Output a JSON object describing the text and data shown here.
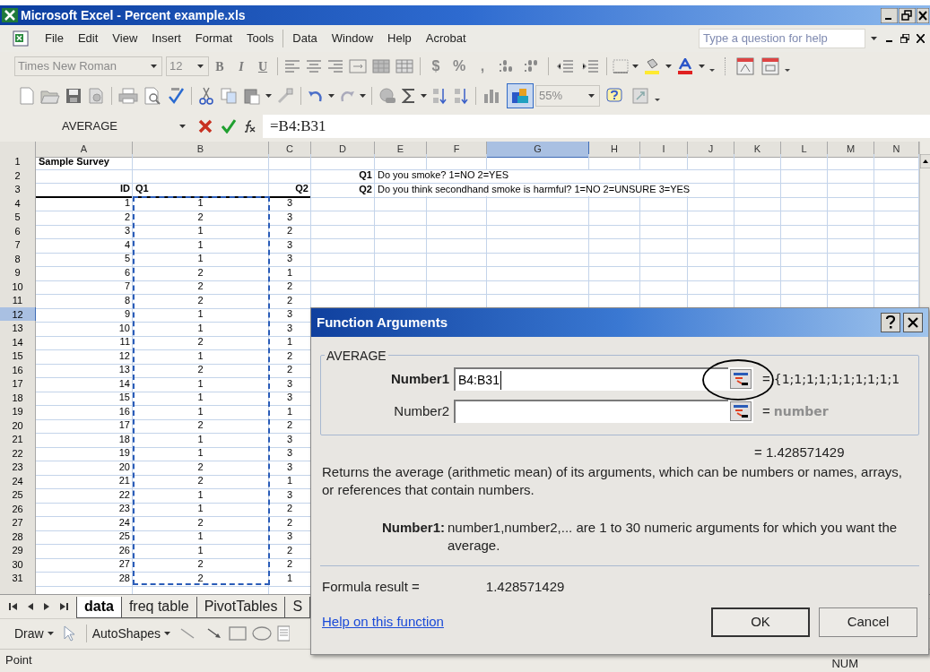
{
  "window": {
    "title": "Microsoft Excel - Percent example.xls"
  },
  "menu": [
    "File",
    "Edit",
    "View",
    "Insert",
    "Format",
    "Tools",
    "Data",
    "Window",
    "Help",
    "Acrobat"
  ],
  "help_box": {
    "placeholder": "Type a question for help"
  },
  "formatting_toolbar": {
    "font": "Times New Roman",
    "size": "12",
    "style_buttons": [
      "B",
      "I",
      "U"
    ],
    "number_buttons": [
      "$",
      "%",
      ","
    ]
  },
  "standard_toolbar": {
    "zoom": "55%"
  },
  "formula_bar": {
    "name_box": "AVERAGE",
    "formula": "=B4:B31"
  },
  "sheet": {
    "columns": [
      {
        "label": "A",
        "selected": false
      },
      {
        "label": "B",
        "selected": false
      },
      {
        "label": "C",
        "selected": false
      },
      {
        "label": "D",
        "selected": false
      },
      {
        "label": "E",
        "selected": false
      },
      {
        "label": "F",
        "selected": false
      },
      {
        "label": "G",
        "selected": true
      },
      {
        "label": "H",
        "selected": false
      },
      {
        "label": "I",
        "selected": false
      },
      {
        "label": "J",
        "selected": false
      },
      {
        "label": "K",
        "selected": false
      },
      {
        "label": "L",
        "selected": false
      },
      {
        "label": "M",
        "selected": false
      },
      {
        "label": "N",
        "selected": false
      }
    ],
    "rows": [
      {
        "number": "1",
        "selected": false,
        "kind": "title",
        "col_a": "Sample Survey"
      },
      {
        "number": "2",
        "selected": false,
        "kind": "note",
        "col_d": "Q1",
        "col_e": "Do you smoke? 1=NO  2=YES"
      },
      {
        "number": "3",
        "selected": false,
        "kind": "header",
        "col_a": "ID",
        "col_b": "Q1",
        "col_c": "Q2",
        "col_d": "Q2",
        "col_e": "Do you think secondhand smoke is harmful?  1=NO  2=UNSURE  3=YES"
      },
      {
        "number": "4",
        "selected": false,
        "kind": "data",
        "col_a": "1",
        "col_b": "1",
        "col_c": "3"
      },
      {
        "number": "5",
        "selected": false,
        "kind": "data",
        "col_a": "2",
        "col_b": "2",
        "col_c": "3"
      },
      {
        "number": "6",
        "selected": false,
        "kind": "data",
        "col_a": "3",
        "col_b": "1",
        "col_c": "2"
      },
      {
        "number": "7",
        "selected": false,
        "kind": "data",
        "col_a": "4",
        "col_b": "1",
        "col_c": "3"
      },
      {
        "number": "8",
        "selected": false,
        "kind": "data",
        "col_a": "5",
        "col_b": "1",
        "col_c": "3"
      },
      {
        "number": "9",
        "selected": false,
        "kind": "data",
        "col_a": "6",
        "col_b": "2",
        "col_c": "1"
      },
      {
        "number": "10",
        "selected": false,
        "kind": "data",
        "col_a": "7",
        "col_b": "2",
        "col_c": "2"
      },
      {
        "number": "11",
        "selected": false,
        "kind": "data",
        "col_a": "8",
        "col_b": "2",
        "col_c": "2"
      },
      {
        "number": "12",
        "selected": true,
        "kind": "data",
        "col_a": "9",
        "col_b": "1",
        "col_c": "3"
      },
      {
        "number": "13",
        "selected": false,
        "kind": "data",
        "col_a": "10",
        "col_b": "1",
        "col_c": "3"
      },
      {
        "number": "14",
        "selected": false,
        "kind": "data",
        "col_a": "11",
        "col_b": "2",
        "col_c": "1"
      },
      {
        "number": "15",
        "selected": false,
        "kind": "data",
        "col_a": "12",
        "col_b": "1",
        "col_c": "2"
      },
      {
        "number": "16",
        "selected": false,
        "kind": "data",
        "col_a": "13",
        "col_b": "2",
        "col_c": "2"
      },
      {
        "number": "17",
        "selected": false,
        "kind": "data",
        "col_a": "14",
        "col_b": "1",
        "col_c": "3"
      },
      {
        "number": "18",
        "selected": false,
        "kind": "data",
        "col_a": "15",
        "col_b": "1",
        "col_c": "3"
      },
      {
        "number": "19",
        "selected": false,
        "kind": "data",
        "col_a": "16",
        "col_b": "1",
        "col_c": "1"
      },
      {
        "number": "20",
        "selected": false,
        "kind": "data",
        "col_a": "17",
        "col_b": "2",
        "col_c": "2"
      },
      {
        "number": "21",
        "selected": false,
        "kind": "data",
        "col_a": "18",
        "col_b": "1",
        "col_c": "3"
      },
      {
        "number": "22",
        "selected": false,
        "kind": "data",
        "col_a": "19",
        "col_b": "1",
        "col_c": "3"
      },
      {
        "number": "23",
        "selected": false,
        "kind": "data",
        "col_a": "20",
        "col_b": "2",
        "col_c": "3"
      },
      {
        "number": "24",
        "selected": false,
        "kind": "data",
        "col_a": "21",
        "col_b": "2",
        "col_c": "1"
      },
      {
        "number": "25",
        "selected": false,
        "kind": "data",
        "col_a": "22",
        "col_b": "1",
        "col_c": "3"
      },
      {
        "number": "26",
        "selected": false,
        "kind": "data",
        "col_a": "23",
        "col_b": "1",
        "col_c": "2"
      },
      {
        "number": "27",
        "selected": false,
        "kind": "data",
        "col_a": "24",
        "col_b": "2",
        "col_c": "2"
      },
      {
        "number": "28",
        "selected": false,
        "kind": "data",
        "col_a": "25",
        "col_b": "1",
        "col_c": "3"
      },
      {
        "number": "29",
        "selected": false,
        "kind": "data",
        "col_a": "26",
        "col_b": "1",
        "col_c": "2"
      },
      {
        "number": "30",
        "selected": false,
        "kind": "data",
        "col_a": "27",
        "col_b": "2",
        "col_c": "2"
      },
      {
        "number": "31",
        "selected": false,
        "kind": "data",
        "col_a": "28",
        "col_b": "2",
        "col_c": "1"
      }
    ]
  },
  "sheet_tabs": [
    {
      "label": "data",
      "selected": true
    },
    {
      "label": "freq table",
      "selected": false
    },
    {
      "label": "PivotTables",
      "selected": false
    },
    {
      "label": "S",
      "selected": false
    }
  ],
  "drawing_toolbar": [
    "Draw",
    "AutoShapes"
  ],
  "status_bar": {
    "mode": "Point",
    "indicator": "NUM"
  },
  "dialog": {
    "title": "Function Arguments",
    "function": "AVERAGE",
    "arguments": [
      {
        "label": "Number1",
        "required": true,
        "value": "B4:B31",
        "equals": "=",
        "result": "{1;1;1;1;1;1;1;1;1;1",
        "circled": true
      },
      {
        "label": "Number2",
        "required": false,
        "equals": "=",
        "result": "number",
        "circled": false
      }
    ],
    "value": "= 1.428571429",
    "description": "Returns the average (arithmetic mean) of its arguments, which can be numbers or names, arrays, or references that contain numbers.",
    "argument_help": {
      "label": "Number1:",
      "text": "number1,number2,... are 1 to 30 numeric arguments for which you want the average."
    },
    "result_label": "Formula result =",
    "result_value": "1.428571429",
    "help_link": "Help on this function",
    "buttons": [
      "OK",
      "Cancel"
    ]
  }
}
